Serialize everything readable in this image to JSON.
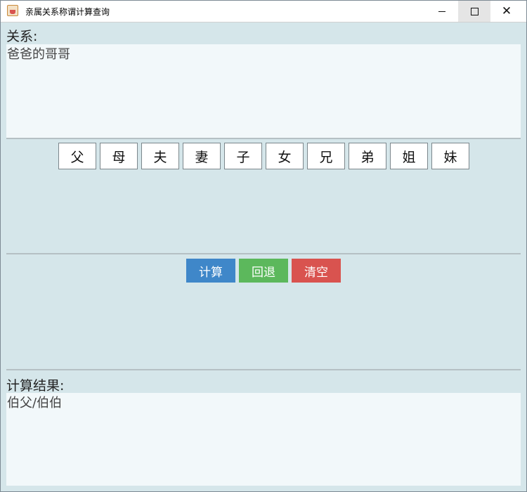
{
  "window": {
    "title": "亲属关系称谓计算查询"
  },
  "relation": {
    "label": "关系:",
    "value": "爸爸的哥哥"
  },
  "kin_buttons": [
    "父",
    "母",
    "夫",
    "妻",
    "子",
    "女",
    "兄",
    "弟",
    "姐",
    "妹"
  ],
  "actions": {
    "calculate": "计算",
    "back": "回退",
    "clear": "清空"
  },
  "result": {
    "label": "计算结果:",
    "value": "伯父/伯伯"
  },
  "colors": {
    "calculate": "#3f87c9",
    "back": "#5cb85c",
    "clear": "#d9534f",
    "panel_bg": "#d5e6ea",
    "text_area_bg": "#f2f8fa"
  },
  "icons": {
    "app": "java-cup-icon",
    "minimize": "minimize-icon",
    "maximize": "maximize-icon",
    "close": "close-icon"
  }
}
